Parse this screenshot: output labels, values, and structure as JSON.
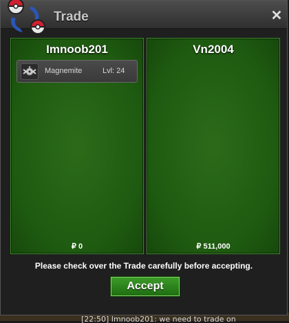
{
  "window": {
    "title": "Trade",
    "close_glyph": "✕"
  },
  "left_panel": {
    "player_name": "Imnoob201",
    "items": [
      {
        "name": "Magnemite",
        "level_text": "Lvl: 24",
        "icon": "magnemite-icon"
      }
    ],
    "money": "₽ 0"
  },
  "right_panel": {
    "player_name": "Vn2004",
    "items": [],
    "money": "₽ 511,000"
  },
  "footer": {
    "notice": "Please check over the Trade carefully before accepting.",
    "accept_label": "Accept"
  },
  "background_chat": {
    "text": "[22:50] Imnoob201: we need to trade on"
  },
  "colors": {
    "panel_green": "#1e5a10",
    "accept_green": "#2f8a1e",
    "titlebar_gray": "#3f3f3f"
  }
}
